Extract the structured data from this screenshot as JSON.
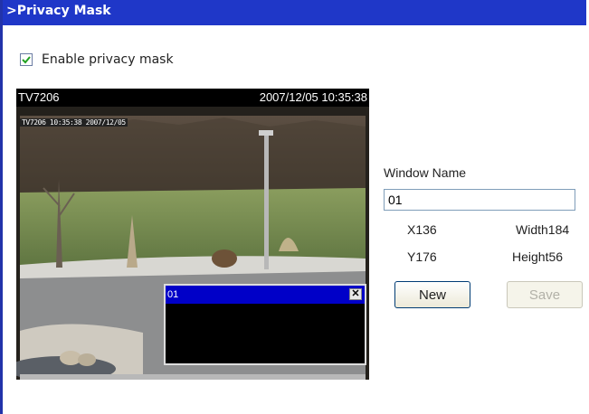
{
  "header": {
    "title": ">Privacy Mask"
  },
  "enable": {
    "label": "Enable privacy mask",
    "checked": true
  },
  "camera": {
    "name": "TV7206",
    "datetime": "2007/12/05 10:35:38",
    "osd_text": "TV7206 10:35:38 2007/12/05"
  },
  "mask_window": {
    "title": "01",
    "close_glyph": "✕"
  },
  "panel": {
    "window_name_label": "Window Name",
    "window_name_value": "01",
    "x_text": "X136",
    "y_text": "Y176",
    "width_text": "Width184",
    "height_text": "Height56",
    "new_label": "New",
    "save_label": "Save"
  },
  "colors": {
    "header_bg": "#1f37c8",
    "mask_title_bg": "#0000c8"
  }
}
